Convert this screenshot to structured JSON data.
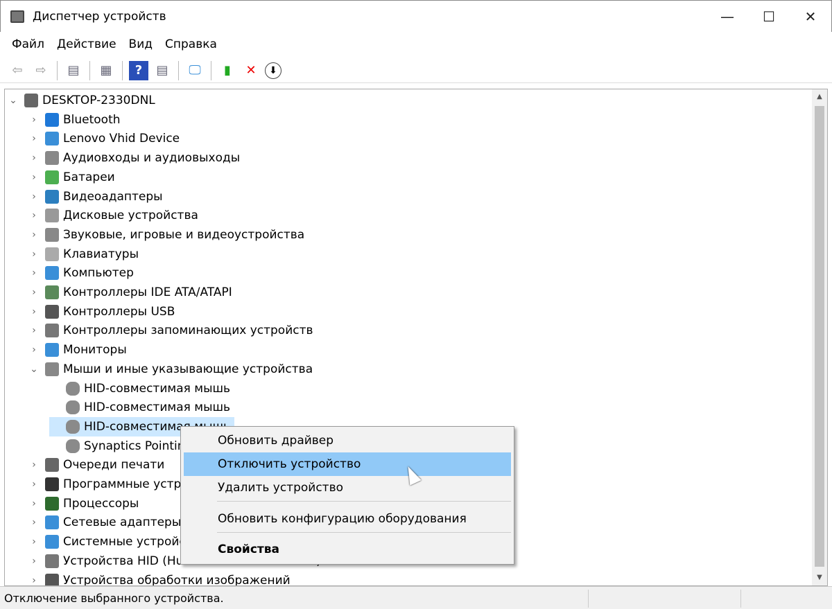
{
  "window": {
    "title": "Диспетчер устройств",
    "minimize": "—",
    "maximize": "☐",
    "close": "✕"
  },
  "menu": [
    "Файл",
    "Действие",
    "Вид",
    "Справка"
  ],
  "toolbar": [
    {
      "icon": "back-arrow-icon",
      "glyph": "⇦"
    },
    {
      "icon": "forward-arrow-icon",
      "glyph": "⇨"
    },
    {
      "icon": "console-tree-icon",
      "glyph": "▤"
    },
    {
      "icon": "properties-icon",
      "glyph": "▦"
    },
    {
      "icon": "help-icon",
      "glyph": "?"
    },
    {
      "icon": "action-pane-icon",
      "glyph": "▤"
    },
    {
      "icon": "scan-hardware-icon",
      "glyph": "🖵"
    },
    {
      "icon": "update-driver-icon",
      "glyph": "▮"
    },
    {
      "icon": "uninstall-icon",
      "glyph": "✕"
    },
    {
      "icon": "disable-device-icon",
      "glyph": "⬇"
    }
  ],
  "tree": {
    "root": "DESKTOP-2330DNL",
    "items": [
      {
        "label": "Bluetooth",
        "color": "#1e78d8"
      },
      {
        "label": "Lenovo Vhid Device",
        "color": "#3a8fd8"
      },
      {
        "label": "Аудиовходы и аудиовыходы",
        "color": "#888888"
      },
      {
        "label": "Батареи",
        "color": "#4caf50"
      },
      {
        "label": "Видеоадаптеры",
        "color": "#2c7fbf"
      },
      {
        "label": "Дисковые устройства",
        "color": "#999999"
      },
      {
        "label": "Звуковые, игровые и видеоустройства",
        "color": "#888888"
      },
      {
        "label": "Клавиатуры",
        "color": "#aaaaaa"
      },
      {
        "label": "Компьютер",
        "color": "#3a8fd8"
      },
      {
        "label": "Контроллеры IDE ATA/ATAPI",
        "color": "#5a8a5a"
      },
      {
        "label": "Контроллеры USB",
        "color": "#555555"
      },
      {
        "label": "Контроллеры запоминающих устройств",
        "color": "#777777"
      },
      {
        "label": "Мониторы",
        "color": "#3a8fd8"
      },
      {
        "label": "Мыши и иные указывающие устройства",
        "color": "#888888",
        "expanded": true,
        "children": [
          "HID-совместимая мышь",
          "HID-совместимая мышь",
          "HID-совместимая мышь",
          "Synaptics Pointing Device"
        ]
      },
      {
        "label": "Очереди печати",
        "color": "#666666"
      },
      {
        "label": "Программные устройства",
        "color": "#333333"
      },
      {
        "label": "Процессоры",
        "color": "#2e6b2e"
      },
      {
        "label": "Сетевые адаптеры",
        "color": "#3a8fd8"
      },
      {
        "label": "Системные устройства",
        "color": "#3a8fd8"
      },
      {
        "label": "Устройства HID (Human Interface Devices)",
        "color": "#777777"
      },
      {
        "label": "Устройства обработки изображений",
        "color": "#555555"
      }
    ]
  },
  "context_menu": {
    "items": [
      "Обновить драйвер",
      "Отключить устройство",
      "Удалить устройство",
      "Обновить конфигурацию оборудования",
      "Свойства"
    ],
    "highlighted": 1
  },
  "status": "Отключение выбранного устройства."
}
